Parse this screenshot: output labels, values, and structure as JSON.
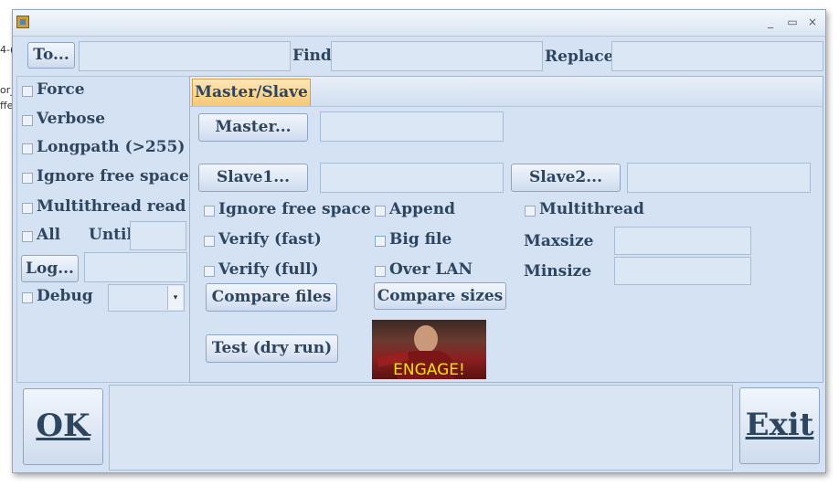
{
  "background": {
    "fragments": [
      "4-(",
      "or_",
      "ffe"
    ]
  },
  "window": {
    "controls": {
      "minimize": "_",
      "maximize": "▭",
      "close": "×"
    }
  },
  "toolbar": {
    "to_button": "To...",
    "to_value": "",
    "find_label": "Find",
    "find_value": "",
    "replace_label": "Replace",
    "replace_value": ""
  },
  "left_panel": {
    "force": "Force",
    "verbose": "Verbose",
    "longpath": "Longpath (>255)",
    "ignore_free_space": "Ignore free space",
    "multithread_read": "Multithread read",
    "all": "All",
    "until_label": "Until",
    "until_value": "",
    "log_button": "Log...",
    "log_value": "",
    "debug": "Debug",
    "debug_select_value": ""
  },
  "tabs": [
    {
      "label": "Master/Slave",
      "active": true
    }
  ],
  "master_slave": {
    "master_button": "Master...",
    "master_value": "",
    "slave1_button": "Slave1...",
    "slave1_value": "",
    "slave2_button": "Slave2...",
    "slave2_value": "",
    "ignore_free_space": "Ignore free space",
    "append": "Append",
    "multithread": "Multithread",
    "verify_fast": "Verify (fast)",
    "big_file": "Big file",
    "maxsize_label": "Maxsize",
    "maxsize_value": "",
    "verify_full": "Verify (full)",
    "over_lan": "Over LAN",
    "minsize_label": "Minsize",
    "minsize_value": "",
    "compare_files": "Compare files",
    "compare_sizes": "Compare sizes",
    "test_dry_run": "Test (dry run)",
    "image_caption": "ENGAGE!"
  },
  "bottom": {
    "ok_button": "OK",
    "status_text": "",
    "exit_button": "Exit"
  },
  "icons": {
    "app": "app-icon",
    "dropdown": "chevron-down-icon"
  },
  "colors": {
    "window_bg": "#d4e2f3",
    "text": "#2e4560",
    "active_tab": "#f7c874",
    "field_bg": "#dbe7f5"
  }
}
